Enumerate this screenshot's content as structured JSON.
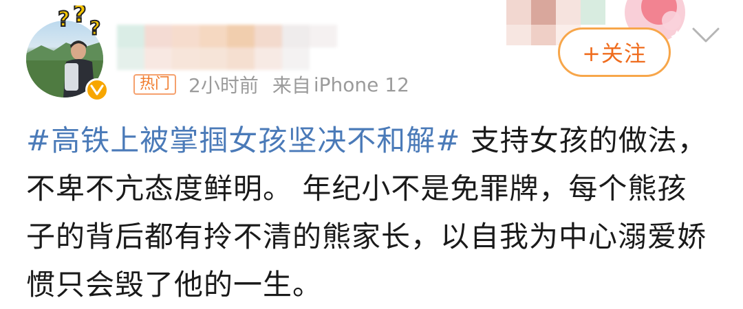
{
  "post": {
    "badge": "热门",
    "time": "2小时前",
    "source_prefix": "来自",
    "source_device": "iPhone 12",
    "follow_label": "+关注",
    "hashtag": "#高铁上被掌掴女孩坚决不和解#",
    "body": " 支持女孩的做法，不卑不亢态度鲜明。 年纪小不是免罪牌，每个熊孩子的背后都有拎不清的熊家长，以自我为中心溺爱娇惯只会毁了他的一生。"
  },
  "colors": {
    "hashtag": "#4a7ab8",
    "follow_orange": "#ef6c1d",
    "badge_orange": "#f07b2c",
    "verified_gold": "#f7a600",
    "meta_gray": "#9b9b9b"
  },
  "icons": {
    "avatar_decoration": "question-marks-icon",
    "verified": "verified-v-icon",
    "menu": "chevron-down-icon"
  }
}
